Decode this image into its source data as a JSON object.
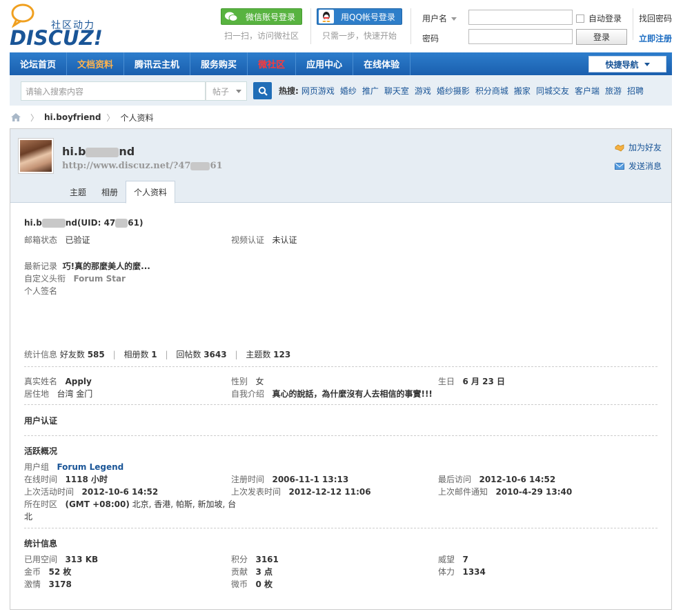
{
  "header": {
    "slogan": "社区动力",
    "brand": "DISCUZ!",
    "wechat_login": "微信账号登录",
    "wechat_sub": "扫一扫，访问微社区",
    "qq_login": "用QQ帐号登录",
    "qq_sub": "只需一步，快速开始",
    "username_label": "用户名",
    "password_label": "密码",
    "auto_login": "自动登录",
    "login_button": "登录",
    "forgot_password": "找回密码",
    "register": "立即注册"
  },
  "nav": {
    "items": [
      "论坛首页",
      "文档资料",
      "腾讯云主机",
      "服务购买",
      "微社区",
      "应用中心",
      "在线体验"
    ],
    "quick_nav": "快捷导航"
  },
  "search": {
    "placeholder": "请输入搜索内容",
    "type": "帖子",
    "hot_label": "热搜:",
    "hot_items": [
      "网页游戏",
      "婚纱",
      "推广",
      "聊天室",
      "游戏",
      "婚纱摄影",
      "积分商城",
      "搬家",
      "同城交友",
      "客户端",
      "旅游",
      "招聘"
    ]
  },
  "breadcrumb": {
    "user": "hi.boyfriend",
    "page": "个人资料"
  },
  "profile": {
    "name_a": "hi.b",
    "name_b": "nd",
    "url_a": "http://www.discuz.net/?47",
    "url_b": "61",
    "add_friend": "加为好友",
    "send_message": "发送消息",
    "tabs": [
      "主题",
      "相册",
      "个人资料"
    ],
    "uid_line_a": "hi.b",
    "uid_line_b": "nd(UID: 47",
    "uid_line_c": "61)",
    "email_label": "邮箱状态",
    "email_value": "已验证",
    "video_label": "视频认证",
    "video_value": "未认证",
    "latest_label": "最新记录",
    "latest_value": "巧!真的那麼美人的麼...",
    "title_label": "自定义头衔",
    "title_value": "Forum Star",
    "sign_label": "个人签名",
    "stats_label": "统计信息",
    "friends_label": "好友数",
    "friends": "585",
    "albums_label": "相册数",
    "albums": "1",
    "replies_label": "回帖数",
    "replies": "3643",
    "threads_label": "主题数",
    "threads": "123",
    "realname_label": "真实姓名",
    "realname": "Apply",
    "gender_label": "性别",
    "gender": "女",
    "birthday_label": "生日",
    "birthday": "6 月 23 日",
    "residence_label": "居住地",
    "residence": "台湾 金门",
    "intro_label": "自我介绍",
    "intro": "真心的說話，為什麼沒有人去相信的事實!!!",
    "verify_heading": "用户认证",
    "activity_heading": "活跃概况",
    "group_label": "用户组",
    "group": "Forum Legend",
    "online_label": "在线时间",
    "online": "1118 小时",
    "regtime_label": "注册时间",
    "regtime": "2006-11-1 13:13",
    "lastvisit_label": "最后访问",
    "lastvisit": "2012-10-6 14:52",
    "lastactive_label": "上次活动时间",
    "lastactive": "2012-10-6 14:52",
    "lastpost_label": "上次发表时间",
    "lastpost": "2012-12-12 11:06",
    "lastmail_label": "上次邮件通知",
    "lastmail": "2010-4-29 13:40",
    "tz_label": "所在时区",
    "tz_bold": "(GMT +08:00)",
    "tz_rest": " 北京, 香港, 帕斯, 新加坡, 台",
    "tz_rest2": "北",
    "stat_heading": "统计信息",
    "space_label": "已用空间",
    "space": "313 KB",
    "points_label": "积分",
    "points": "3161",
    "prestige_label": "威望",
    "prestige": "7",
    "gold_label": "金币",
    "gold": "52 枚",
    "contrib_label": "贡献",
    "contrib": "3 点",
    "stamina_label": "体力",
    "stamina": "1334",
    "passion_label": "激情",
    "passion": "3178",
    "wei_label": "微币",
    "wei": "0 枚"
  }
}
